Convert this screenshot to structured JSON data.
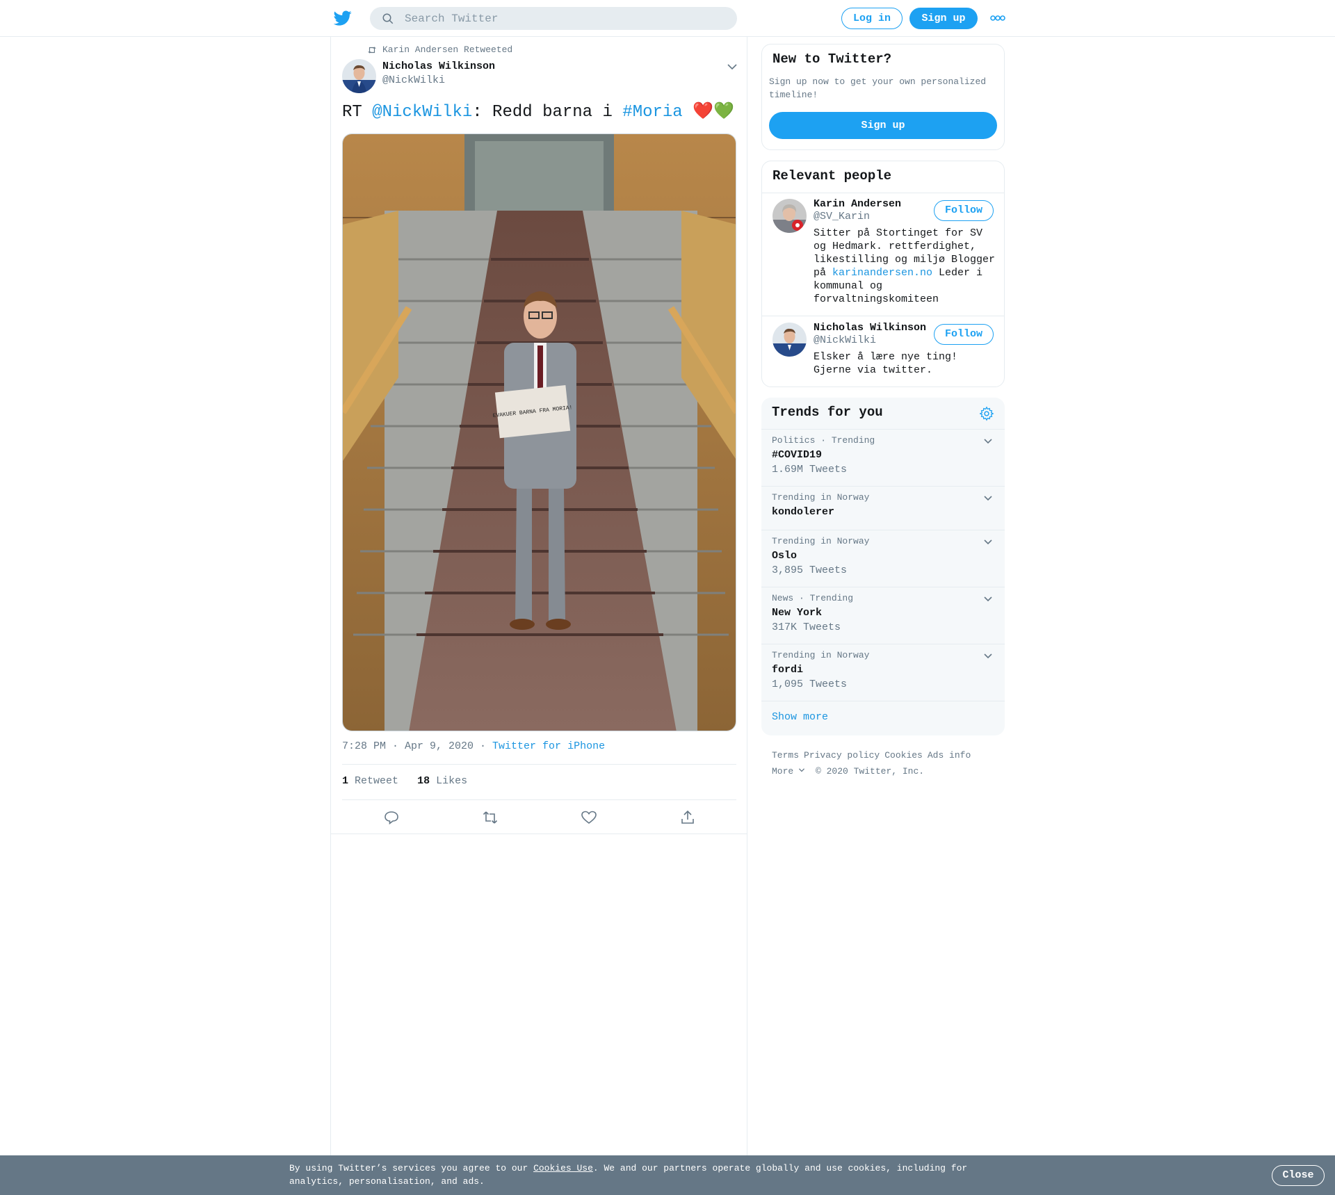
{
  "header": {
    "search_placeholder": "Search Twitter",
    "login_label": "Log in",
    "signup_label": "Sign up",
    "brand_color": "#1da1f2"
  },
  "tweet": {
    "retweeted_by": "Karin Andersen Retweeted",
    "author_name": "Nicholas Wilkinson",
    "author_handle": "@NickWilki",
    "text_prefix": "RT ",
    "text_mention": "@NickWilki",
    "text_mid": ": Redd barna i ",
    "text_hashtag": "#Moria",
    "text_emoji": " ❤️💚",
    "photo_sign_text": "EVAKUER BARNA FRA MORIA!",
    "timestamp": "7:28 PM · Apr 9, 2020 · ",
    "source": "Twitter for iPhone",
    "retweet_count": "1",
    "retweet_label": "Retweet",
    "like_count": "18",
    "like_label": "Likes"
  },
  "new_to_twitter": {
    "title": "New to Twitter?",
    "description": "Sign up now to get your own personalized timeline!",
    "signup_label": "Sign up"
  },
  "relevant_people": {
    "title": "Relevant people",
    "people": [
      {
        "name": "Karin Andersen",
        "handle": "@SV_Karin",
        "follow_label": "Follow",
        "bio_before_link": "Sitter på Stortinget for SV og Hedmark. rettferdighet, likestilling og miljø Blogger på ",
        "bio_link": "karinandersen.no",
        "bio_after_link": " Leder i kommunal og forvaltningskomiteen"
      },
      {
        "name": "Nicholas Wilkinson",
        "handle": "@NickWilki",
        "follow_label": "Follow",
        "bio": "Elsker å lære nye ting! Gjerne via twitter."
      }
    ]
  },
  "trends": {
    "title": "Trends for you",
    "items": [
      {
        "context": "Politics · Trending",
        "name": "#COVID19",
        "count": "1.69M Tweets"
      },
      {
        "context": "Trending in Norway",
        "name": "kondolerer",
        "count": ""
      },
      {
        "context": "Trending in Norway",
        "name": "Oslo",
        "count": "3,895 Tweets"
      },
      {
        "context": "News · Trending",
        "name": "New York",
        "count": "317K Tweets"
      },
      {
        "context": "Trending in Norway",
        "name": "fordi",
        "count": "1,095 Tweets"
      }
    ],
    "show_more": "Show more"
  },
  "footer": {
    "terms": "Terms",
    "privacy": "Privacy policy",
    "cookies": "Cookies",
    "ads_info": "Ads info",
    "more": "More",
    "copyright": "© 2020 Twitter, Inc."
  },
  "cookie_bar": {
    "text_before": "By using Twitter’s services you agree to our ",
    "link": "Cookies Use",
    "text_after": ". We and our partners operate globally and use cookies, including for analytics, personalisation, and ads.",
    "close_label": "Close"
  }
}
